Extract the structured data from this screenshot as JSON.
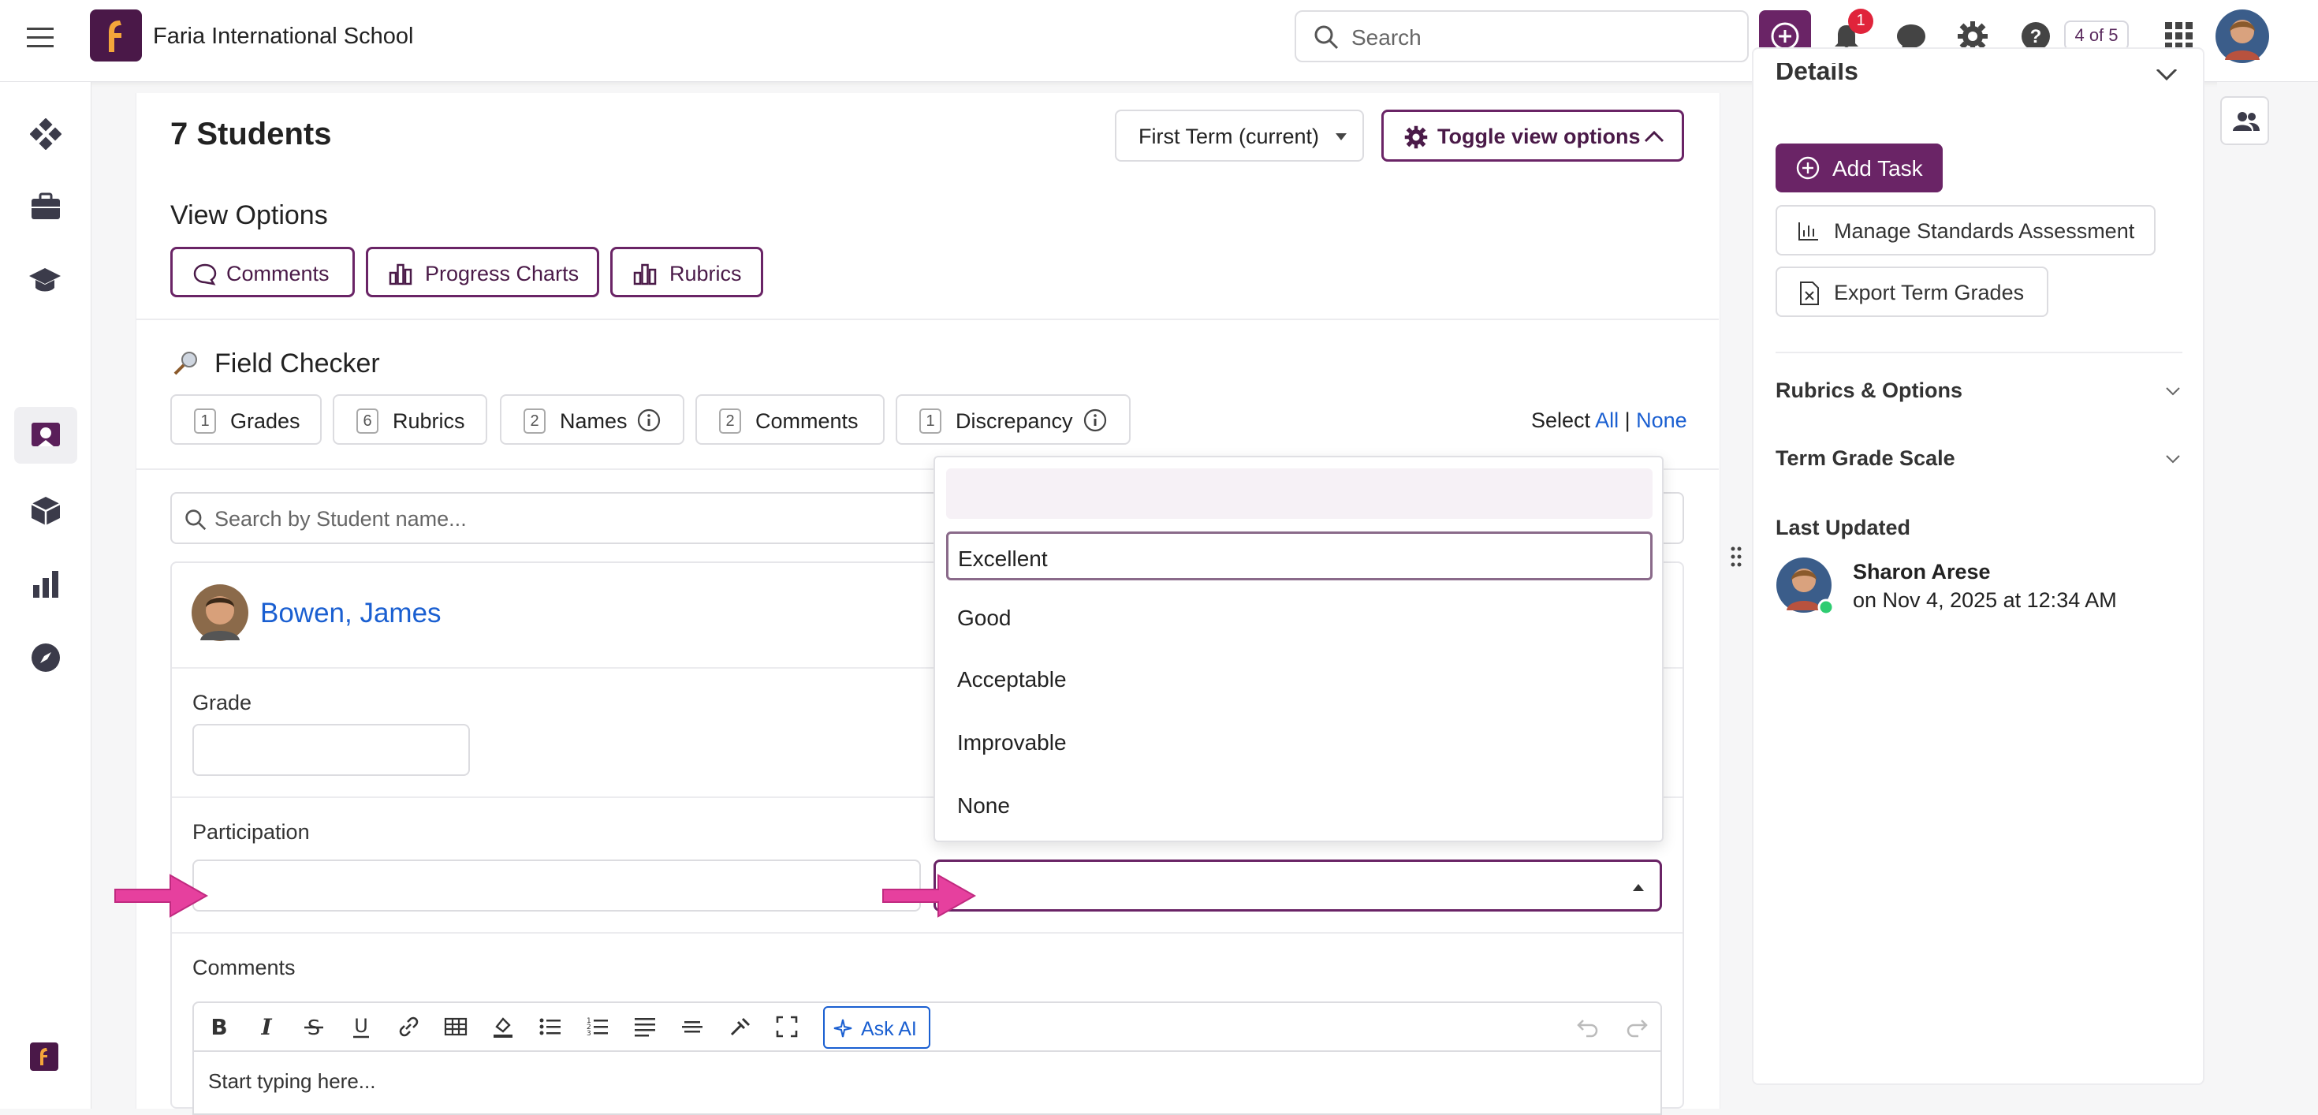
{
  "topbar": {
    "school_name": "Faria International School",
    "search_placeholder": "Search",
    "notification_count": "1",
    "pager": "4 of 5"
  },
  "main": {
    "title": "7 Students",
    "term_select": "First Term (current)",
    "toggle_view_label": "Toggle view options",
    "view_options_title": "View Options",
    "view_buttons": [
      "Comments",
      "Progress Charts",
      "Rubrics"
    ],
    "field_checker_title": "Field Checker",
    "chips": [
      {
        "count": "1",
        "label": "Grades"
      },
      {
        "count": "6",
        "label": "Rubrics"
      },
      {
        "count": "2",
        "label": "Names"
      },
      {
        "count": "2",
        "label": "Comments"
      },
      {
        "count": "1",
        "label": "Discrepancy"
      }
    ],
    "select_label": "Select",
    "select_all": "All",
    "select_sep": "|",
    "select_none": "None",
    "student_search_placeholder": "Search by Student name...",
    "student_name": "Bowen, James",
    "grade_label": "Grade",
    "participation_label": "Participation",
    "comments_label": "Comments",
    "ask_ai": "Ask AI",
    "editor_placeholder": "Start typing here..."
  },
  "dropdown": {
    "options": [
      "Excellent",
      "Good",
      "Acceptable",
      "Improvable",
      "None"
    ],
    "highlighted": "Excellent"
  },
  "right_panel": {
    "title_partial": "Details",
    "add_task": "Add Task",
    "manage_standards": "Manage Standards Assessment",
    "export_grades": "Export Term Grades",
    "rubrics_options": "Rubrics & Options",
    "term_grade_scale": "Term Grade Scale",
    "last_updated_label": "Last Updated",
    "updated_by": "Sharon Arese",
    "updated_on": "on Nov 4, 2025 at 12:34 AM"
  },
  "colors": {
    "brand": "#5a1f5a",
    "accent_border": "#6a2466",
    "link": "#1a5fd1",
    "badge": "#e0243b",
    "arrow": "#e6409e"
  }
}
